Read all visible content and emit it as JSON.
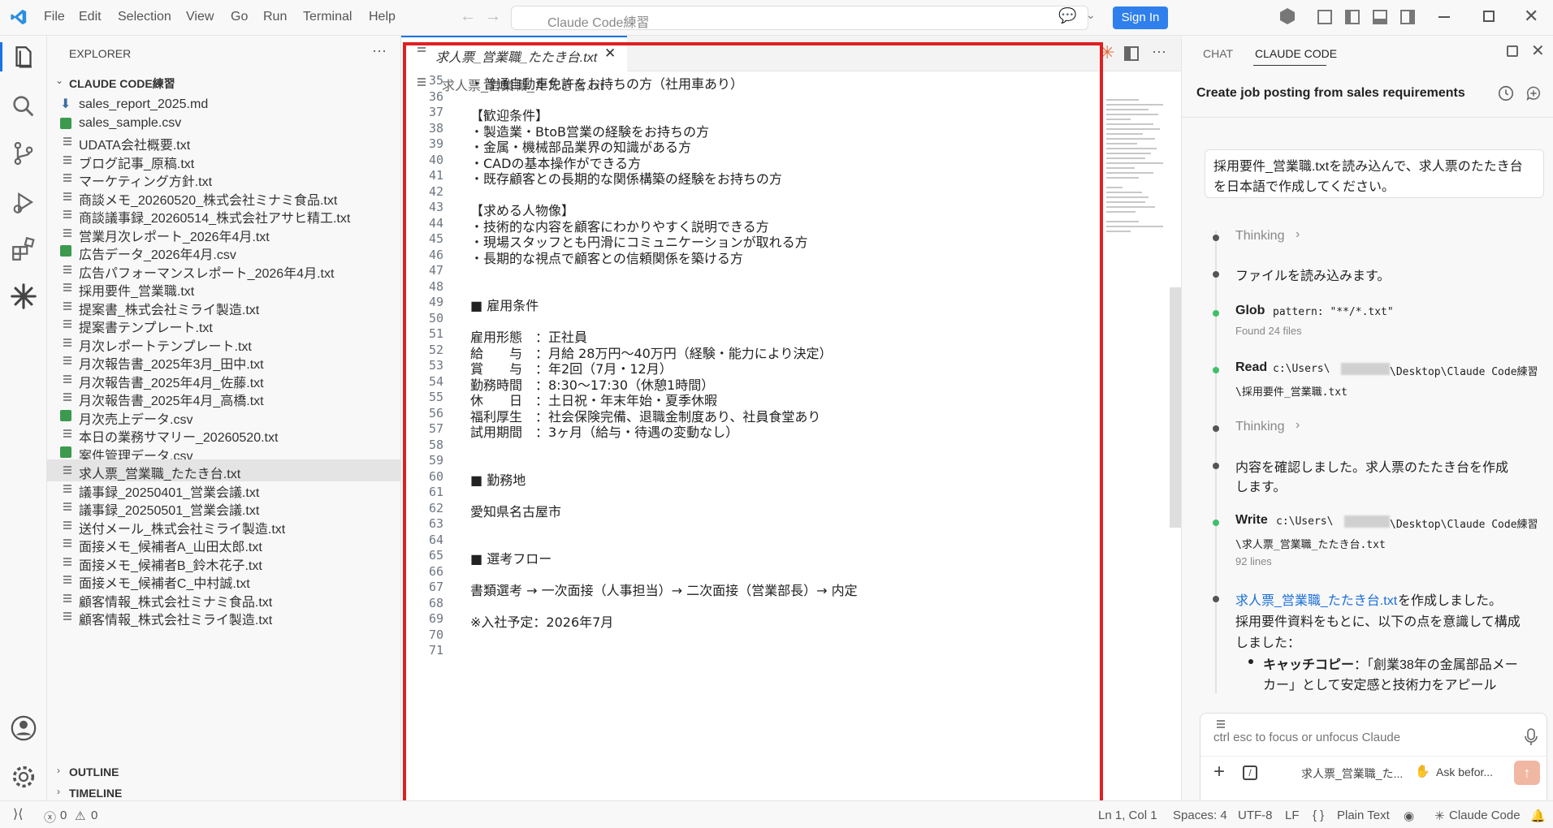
{
  "menu": [
    "File",
    "Edit",
    "Selection",
    "View",
    "Go",
    "Run",
    "Terminal",
    "Help"
  ],
  "search_box": "Claude Code練習",
  "sign_in": "Sign In",
  "explorer": {
    "title": "EXPLORER",
    "project": "CLAUDE CODE練習",
    "files": [
      {
        "name": "sales_report_2025.md",
        "kind": "md"
      },
      {
        "name": "sales_sample.csv",
        "kind": "csv"
      },
      {
        "name": "UDATA会社概要.txt",
        "kind": "txt"
      },
      {
        "name": "ブログ記事_原稿.txt",
        "kind": "txt"
      },
      {
        "name": "マーケティング方針.txt",
        "kind": "txt"
      },
      {
        "name": "商談メモ_20260520_株式会社ミナミ食品.txt",
        "kind": "txt"
      },
      {
        "name": "商談議事録_20260514_株式会社アサヒ精工.txt",
        "kind": "txt"
      },
      {
        "name": "営業月次レポート_2026年4月.txt",
        "kind": "txt"
      },
      {
        "name": "広告データ_2026年4月.csv",
        "kind": "csv"
      },
      {
        "name": "広告パフォーマンスレポート_2026年4月.txt",
        "kind": "txt"
      },
      {
        "name": "採用要件_営業職.txt",
        "kind": "txt"
      },
      {
        "name": "提案書_株式会社ミライ製造.txt",
        "kind": "txt"
      },
      {
        "name": "提案書テンプレート.txt",
        "kind": "txt"
      },
      {
        "name": "月次レポートテンプレート.txt",
        "kind": "txt"
      },
      {
        "name": "月次報告書_2025年3月_田中.txt",
        "kind": "txt"
      },
      {
        "name": "月次報告書_2025年4月_佐藤.txt",
        "kind": "txt"
      },
      {
        "name": "月次報告書_2025年4月_高橋.txt",
        "kind": "txt"
      },
      {
        "name": "月次売上データ.csv",
        "kind": "csv"
      },
      {
        "name": "本日の業務サマリー_20260520.txt",
        "kind": "txt"
      },
      {
        "name": "案件管理データ.csv",
        "kind": "csv"
      },
      {
        "name": "求人票_営業職_たたき台.txt",
        "kind": "txt",
        "selected": true
      },
      {
        "name": "議事録_20250401_営業会議.txt",
        "kind": "txt"
      },
      {
        "name": "議事録_20250501_営業会議.txt",
        "kind": "txt"
      },
      {
        "name": "送付メール_株式会社ミライ製造.txt",
        "kind": "txt"
      },
      {
        "name": "面接メモ_候補者A_山田太郎.txt",
        "kind": "txt"
      },
      {
        "name": "面接メモ_候補者B_鈴木花子.txt",
        "kind": "txt"
      },
      {
        "name": "面接メモ_候補者C_中村誠.txt",
        "kind": "txt"
      },
      {
        "name": "顧客情報_株式会社ミナミ食品.txt",
        "kind": "txt"
      },
      {
        "name": "顧客情報_株式会社ミライ製造.txt",
        "kind": "txt"
      }
    ],
    "outline": "OUTLINE",
    "timeline": "TIMELINE"
  },
  "editor": {
    "tab_name": "求人票_営業職_たたき台.txt",
    "breadcrumb": "求人票_営業職_たたき台.txt",
    "lines": [
      {
        "n": "35",
        "t": "・普通自動車免許をお持ちの方（社用車あり）"
      },
      {
        "n": "36",
        "t": ""
      },
      {
        "n": "37",
        "t": "【歓迎条件】"
      },
      {
        "n": "38",
        "t": "・製造業・BtoB営業の経験をお持ちの方"
      },
      {
        "n": "39",
        "t": "・金属・機械部品業界の知識がある方"
      },
      {
        "n": "40",
        "t": "・CADの基本操作ができる方"
      },
      {
        "n": "41",
        "t": "・既存顧客との長期的な関係構築の経験をお持ちの方"
      },
      {
        "n": "42",
        "t": ""
      },
      {
        "n": "43",
        "t": "【求める人物像】"
      },
      {
        "n": "44",
        "t": "・技術的な内容を顧客にわかりやすく説明できる方"
      },
      {
        "n": "45",
        "t": "・現場スタッフとも円滑にコミュニケーションが取れる方"
      },
      {
        "n": "46",
        "t": "・長期的な視点で顧客との信頼関係を築ける方"
      },
      {
        "n": "47",
        "t": ""
      },
      {
        "n": "48",
        "t": ""
      },
      {
        "n": "49",
        "t": "■ 雇用条件"
      },
      {
        "n": "50",
        "t": ""
      },
      {
        "n": "51",
        "t": "雇用形態　：正社員"
      },
      {
        "n": "52",
        "t": "給　　与　：月給 28万円〜40万円（経験・能力により決定）"
      },
      {
        "n": "53",
        "t": "賞　　与　：年2回（7月・12月）"
      },
      {
        "n": "54",
        "t": "勤務時間　：8:30〜17:30（休憩1時間）"
      },
      {
        "n": "55",
        "t": "休　　日　：土日祝・年末年始・夏季休暇"
      },
      {
        "n": "56",
        "t": "福利厚生　：社会保険完備、退職金制度あり、社員食堂あり"
      },
      {
        "n": "57",
        "t": "試用期間　：3ヶ月（給与・待遇の変動なし）"
      },
      {
        "n": "58",
        "t": ""
      },
      {
        "n": "59",
        "t": ""
      },
      {
        "n": "60",
        "t": "■ 勤務地"
      },
      {
        "n": "61",
        "t": ""
      },
      {
        "n": "62",
        "t": "愛知県名古屋市"
      },
      {
        "n": "63",
        "t": ""
      },
      {
        "n": "64",
        "t": ""
      },
      {
        "n": "65",
        "t": "■ 選考フロー"
      },
      {
        "n": "66",
        "t": ""
      },
      {
        "n": "67",
        "t": "書類選考 → 一次面接（人事担当）→ 二次面接（営業部長）→ 内定"
      },
      {
        "n": "68",
        "t": ""
      },
      {
        "n": "69",
        "t": "※入社予定：2026年7月"
      },
      {
        "n": "70",
        "t": ""
      },
      {
        "n": "71",
        "t": ""
      }
    ]
  },
  "panel": {
    "tab_chat": "CHAT",
    "tab_claude": "CLAUDE CODE",
    "title": "Create job posting from sales requirements",
    "user_message": "採用要件_営業職.txtを読み込んで、求人票のたたき台を日本語で作成してください。",
    "steps": {
      "thinking1": "Thinking",
      "read_file": "ファイルを読み込みます。",
      "glob_label": "Glob",
      "glob_arg": "pattern: \"**/*.txt\"",
      "glob_result": "Found 24 files",
      "read_label": "Read",
      "read_arg1": "c:\\Users\\",
      "read_arg2": "\\Desktop\\Claude Code練習",
      "read_arg3": "\\採用要件_営業職.txt",
      "thinking2": "Thinking",
      "confirm1": "内容を確認しました。求人票のたたき台を作成",
      "confirm2": "します。",
      "write_label": "Write",
      "write_arg1": "c:\\Users\\",
      "write_arg2": "\\Desktop\\Claude Code練習",
      "write_arg3": "\\求人票_営業職_たたき台.txt",
      "write_result": "92 lines",
      "created_link": "求人票_営業職_たたき台.txt",
      "created_text": " を作成しました。",
      "summary1": "採用要件資料をもとに、以下の点を意識して構成",
      "summary2": "しました：",
      "bullet_title": "キャッチコピー",
      "bullet1": "：「創業38年の金属部品メー",
      "bullet2": "カー」として安定感と技術力をアピール"
    },
    "input_placeholder": "ctrl esc to focus or unfocus Claude",
    "input_file_chip": "求人票_営業職_た...",
    "ask_before": "Ask befor..."
  },
  "status": {
    "errors": "0",
    "warnings": "0",
    "position": "Ln 1, Col 1",
    "spaces": "Spaces: 4",
    "encoding": "UTF-8",
    "eol": "LF",
    "language": "Plain Text",
    "claude": "Claude Code"
  },
  "colors": {
    "accent": "#2f80ed",
    "highlight_border": "#e02020",
    "csv_icon": "#3c9a4e",
    "step_green": "#3fbf6b"
  }
}
